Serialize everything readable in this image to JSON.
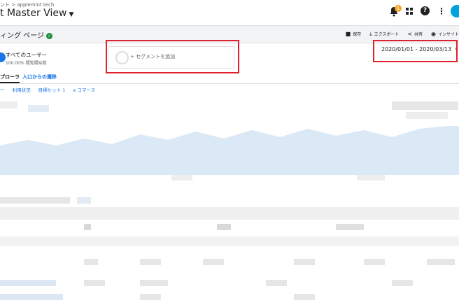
{
  "header": {
    "breadcrumb": "ント > applemint tech",
    "view_title": "t Master View",
    "notification_count": "1",
    "icons": [
      "bell-icon",
      "apps-grid-icon",
      "help-icon",
      "more-vert-icon",
      "account-icon"
    ]
  },
  "report": {
    "title": "ィング ページ",
    "actions": [
      {
        "label": "保存",
        "icon": "save-icon"
      },
      {
        "label": "エクスポート",
        "icon": "download-icon"
      },
      {
        "label": "共有",
        "icon": "share-icon"
      },
      {
        "label": "インサイト",
        "icon": "insight-icon"
      }
    ]
  },
  "segments": {
    "active_name": "すべてのユーザー",
    "active_sub": "100.00% 閲覧開始数",
    "add_label": "+ セグメントを追加"
  },
  "date_range": "2020/01/01 - 2020/03/13",
  "tabs": [
    "プローラ",
    "入口からの遷移"
  ],
  "subtabs": [
    "ー",
    "利用状況",
    "目標セット 1",
    "e コマース"
  ]
}
